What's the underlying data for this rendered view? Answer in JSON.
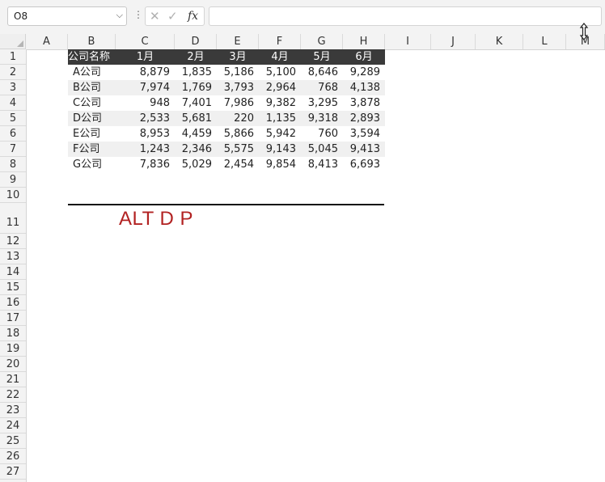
{
  "formula_bar": {
    "name_box_value": "O8",
    "name_box_arrow_icon": "chevron-down-icon",
    "separator": "⋮",
    "cancel_glyph": "✕",
    "enter_glyph": "✓",
    "fx_label": "fx",
    "formula_value": ""
  },
  "columns": [
    "A",
    "B",
    "C",
    "D",
    "E",
    "F",
    "G",
    "H",
    "I",
    "J",
    "K",
    "L",
    "M"
  ],
  "rows": [
    "1",
    "2",
    "3",
    "4",
    "5",
    "6",
    "7",
    "8",
    "9",
    "10",
    "11",
    "12",
    "13",
    "14",
    "15",
    "16",
    "17",
    "18",
    "19",
    "20",
    "21",
    "22",
    "23",
    "24",
    "25",
    "26",
    "27"
  ],
  "table": {
    "headers": [
      "公司名称",
      "1月",
      "2月",
      "3月",
      "4月",
      "5月",
      "6月"
    ],
    "rows": [
      [
        "A公司",
        "8,879",
        "1,835",
        "5,186",
        "5,100",
        "8,646",
        "9,289"
      ],
      [
        "B公司",
        "7,974",
        "1,769",
        "3,793",
        "2,964",
        "768",
        "4,138"
      ],
      [
        "C公司",
        "948",
        "7,401",
        "7,986",
        "9,382",
        "3,295",
        "3,878"
      ],
      [
        "D公司",
        "2,533",
        "5,681",
        "220",
        "1,135",
        "9,318",
        "2,893"
      ],
      [
        "E公司",
        "8,953",
        "4,459",
        "5,866",
        "5,942",
        "760",
        "3,594"
      ],
      [
        "F公司",
        "1,243",
        "2,346",
        "5,575",
        "9,143",
        "5,045",
        "9,413"
      ],
      [
        "G公司",
        "7,836",
        "5,029",
        "2,454",
        "9,854",
        "8,413",
        "6,693"
      ]
    ]
  },
  "caption_text": "ALT D P",
  "colors": {
    "table_header_bg": "#3a3a3a",
    "caption": "#b22222",
    "stripe": "#f0f0f0"
  },
  "cursor_icon": "resize-vertical-cursor-icon"
}
